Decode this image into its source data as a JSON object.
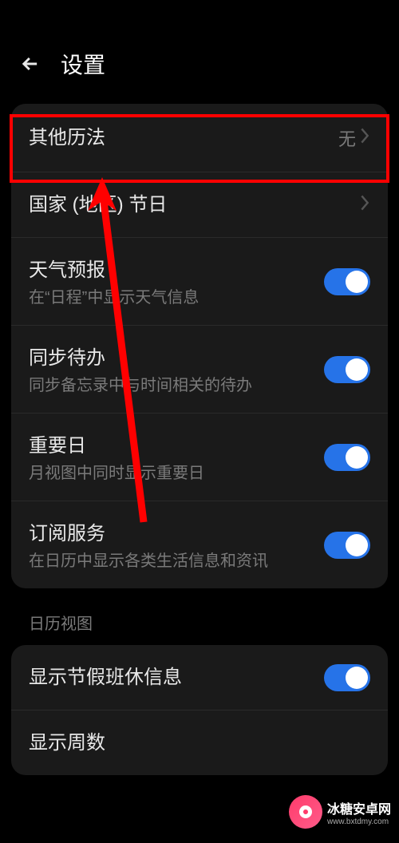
{
  "header": {
    "title": "设置"
  },
  "group1": {
    "alt_calendar": {
      "label": "其他历法",
      "value": "无"
    },
    "country_holiday": {
      "label": "国家 (地区) 节日"
    },
    "weather": {
      "label": "天气预报",
      "desc": "在“日程”中显示天气信息"
    },
    "sync_todo": {
      "label": "同步待办",
      "desc": "同步备忘录中与时间相关的待办"
    },
    "important_day": {
      "label": "重要日",
      "desc": "月视图中同时显示重要日"
    },
    "subscription": {
      "label": "订阅服务",
      "desc": "在日历中显示各类生活信息和资讯"
    }
  },
  "section2_title": "日历视图",
  "group2": {
    "holiday_info": {
      "label": "显示节假班休信息"
    },
    "week_number": {
      "label": "显示周数"
    }
  },
  "watermark": {
    "name": "冰糖安卓网",
    "url": "www.bxtdmy.com"
  }
}
